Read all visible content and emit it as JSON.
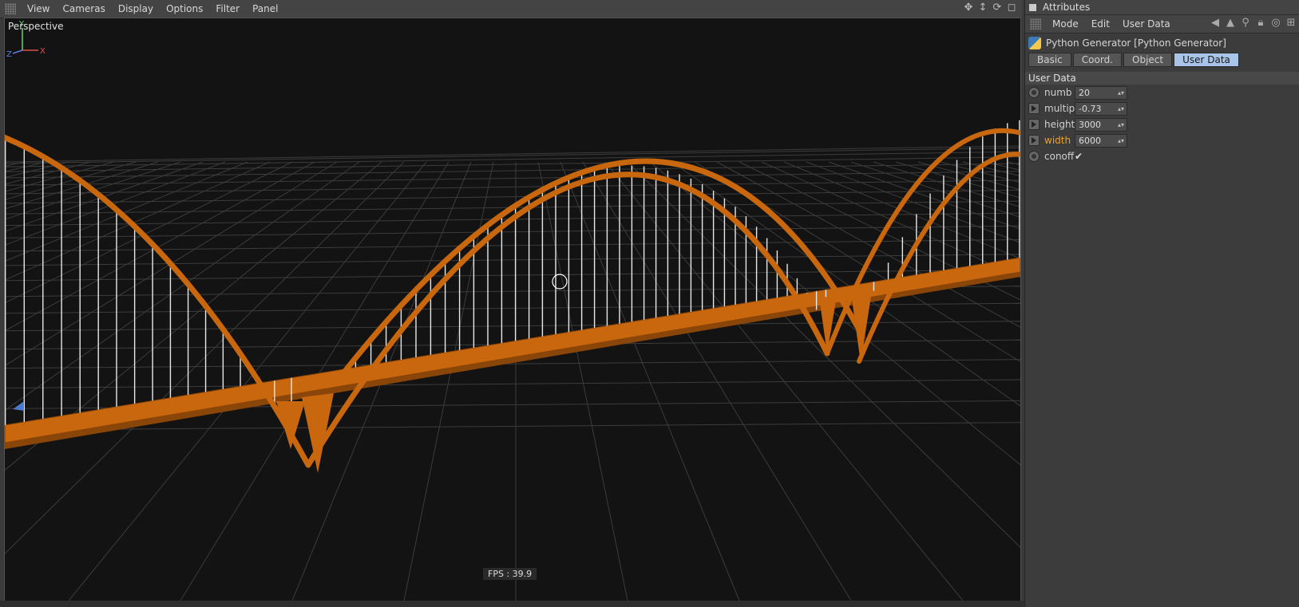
{
  "viewport": {
    "menu": [
      "View",
      "Cameras",
      "Display",
      "Options",
      "Filter",
      "Panel"
    ],
    "camera_label": "Perspective",
    "fps": "FPS : 39.9",
    "axis": {
      "y": "Y",
      "x": "X",
      "z": "Z"
    }
  },
  "attributes": {
    "title": "Attributes",
    "menu": [
      "Mode",
      "Edit",
      "User Data"
    ],
    "object_name": "Python Generator [Python Generator]",
    "tabs": [
      {
        "label": "Basic",
        "active": false
      },
      {
        "label": "Coord.",
        "active": false
      },
      {
        "label": "Object",
        "active": false
      },
      {
        "label": "User Data",
        "active": true
      }
    ],
    "section": "User Data",
    "params": [
      {
        "label": "numb",
        "value": "20"
      },
      {
        "label": "multip",
        "value": "-0.73"
      },
      {
        "label": "height",
        "value": "3000"
      },
      {
        "label": "width",
        "value": "6000"
      },
      {
        "label": "conoff",
        "checked": true
      }
    ]
  },
  "colors": {
    "bridge": "#c8670e",
    "cable": "#e8e8e8",
    "grid": "#3c3c3c",
    "viewport_bg": "#131313"
  }
}
